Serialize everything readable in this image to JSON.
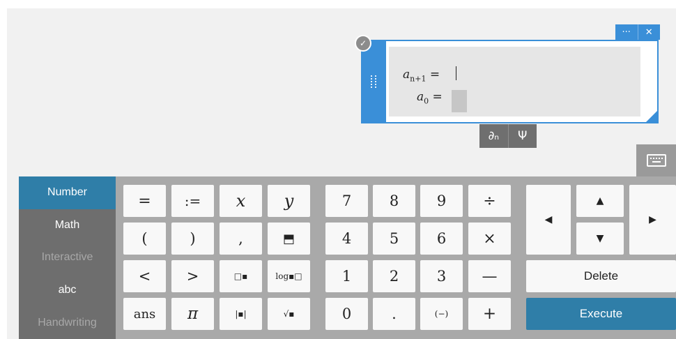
{
  "math_box": {
    "line1_var": "a",
    "line1_sub": "n+1",
    "line1_eq": "=",
    "line2_var": "a",
    "line2_sub": "0",
    "line2_eq": "=",
    "check_icon": "✓",
    "menu_more": "···",
    "menu_close": "✕"
  },
  "mode_bar": {
    "sequence": "∂ₙ",
    "psi": "Ψ"
  },
  "tabs": [
    "Number",
    "Math",
    "Interactive",
    "abc",
    "Handwriting"
  ],
  "tabs_active": "Number",
  "keys": {
    "row1": [
      "=",
      ":=",
      "x",
      "y",
      "7",
      "8",
      "9",
      "÷"
    ],
    "row2": [
      "(",
      ")",
      ",",
      "⬒",
      "4",
      "5",
      "6",
      "×"
    ],
    "row3": [
      "<",
      ">",
      "□▪",
      "log▪□",
      "1",
      "2",
      "3",
      "—"
    ],
    "row4": [
      "ans",
      "π",
      "|▪|",
      "√▪",
      "0",
      ".",
      "(−)",
      "+"
    ]
  },
  "nav": {
    "up": "▲",
    "down": "▼",
    "left": "◀",
    "right": "▶"
  },
  "delete_label": "Delete",
  "execute_label": "Execute",
  "colors": {
    "accent_blue": "#3a8fd8",
    "execute_teal": "#2f7ea8",
    "keyboard_bg": "#a9a9a9",
    "tab_bg": "#6e6e6e"
  }
}
